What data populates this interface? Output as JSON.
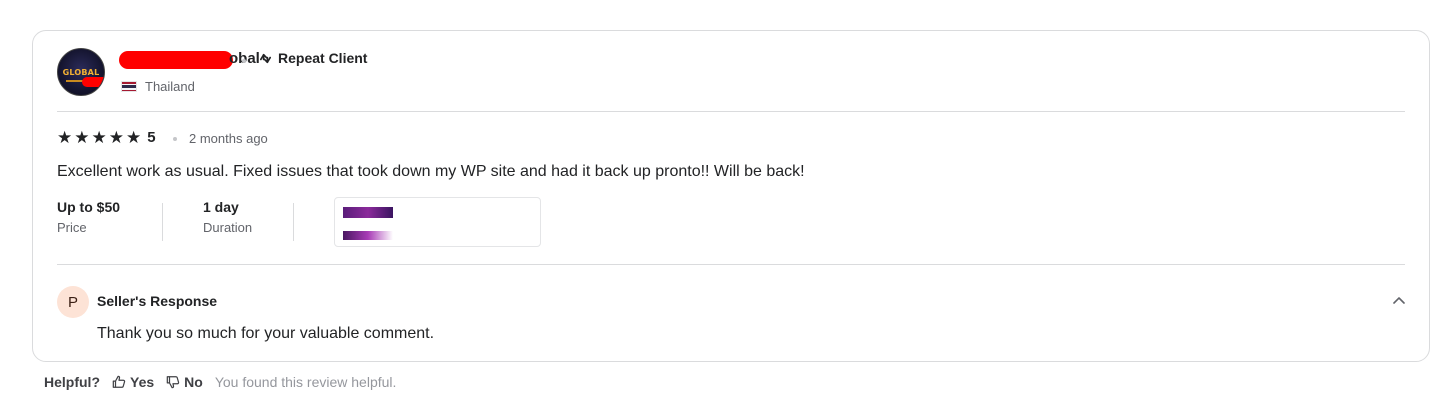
{
  "review": {
    "username_visible": "obal",
    "repeat_label": "Repeat Client",
    "country": "Thailand",
    "rating": "5",
    "age": "2 months ago",
    "text": "Excellent work as usual. Fixed issues that took down my WP site and had it back up pronto!! Will be back!",
    "price_value": "Up to $50",
    "price_label": "Price",
    "duration_value": "1 day",
    "duration_label": "Duration"
  },
  "response": {
    "avatar_letter": "P",
    "title": "Seller's Response",
    "text": "Thank you so much for your valuable comment."
  },
  "helpful": {
    "label": "Helpful?",
    "yes": "Yes",
    "no": "No",
    "note": "You found this review helpful."
  },
  "icons": {
    "star": "star-icon",
    "repeat": "repeat-icon",
    "chevron": "chevron-up-icon",
    "thumbs_up": "thumbs-up-icon",
    "thumbs_down": "thumbs-down-icon"
  },
  "colors": {
    "text": "#222325",
    "muted": "#62646a",
    "border": "#dadbdd",
    "redaction": "#ff0000",
    "response_avatar_bg": "#fde3d6"
  }
}
